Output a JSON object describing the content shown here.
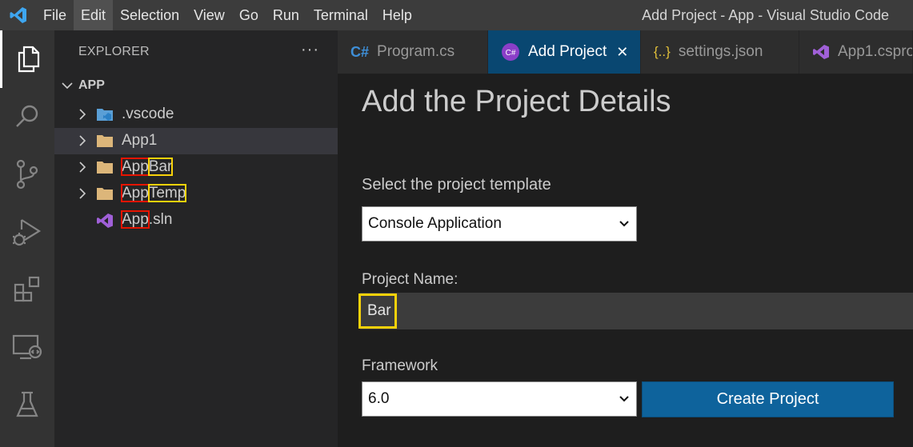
{
  "titlebar": {
    "menu": [
      "File",
      "Edit",
      "Selection",
      "View",
      "Go",
      "Run",
      "Terminal",
      "Help"
    ],
    "active_menu": "Edit",
    "window_title": "Add Project - App - Visual Studio Code"
  },
  "explorer": {
    "header": "EXPLORER",
    "more": "···",
    "root": "APP",
    "items": [
      {
        "name": ".vscode",
        "type": "folder"
      },
      {
        "name": "App1",
        "type": "folder",
        "selected": true
      },
      {
        "name_prefix": "App",
        "name_suffix": "Bar",
        "type": "folder"
      },
      {
        "name_prefix": "App",
        "name_suffix": "Temp",
        "type": "folder"
      },
      {
        "name_prefix": "App",
        "name_suffix": ".sln",
        "type": "solution"
      }
    ]
  },
  "tabs": [
    {
      "label": "Program.cs",
      "icon": "csharp-icon"
    },
    {
      "label": "Add Project",
      "icon": "csharp-circle-icon",
      "active": true,
      "close": "✕"
    },
    {
      "label": "settings.json",
      "icon": "json-icon"
    },
    {
      "label": "App1.cspro",
      "icon": "visual-studio-icon"
    }
  ],
  "form": {
    "heading": "Add the Project Details",
    "template_label": "Select the project template",
    "template_value": "Console Application",
    "name_label": "Project Name:",
    "name_value": "Bar",
    "framework_label": "Framework",
    "framework_value": "6.0",
    "create_button": "Create Project"
  },
  "colors": {
    "highlight_red": "#e51400",
    "highlight_yellow": "#f8d20a",
    "active_tab": "#094771",
    "button": "#0e639c"
  }
}
